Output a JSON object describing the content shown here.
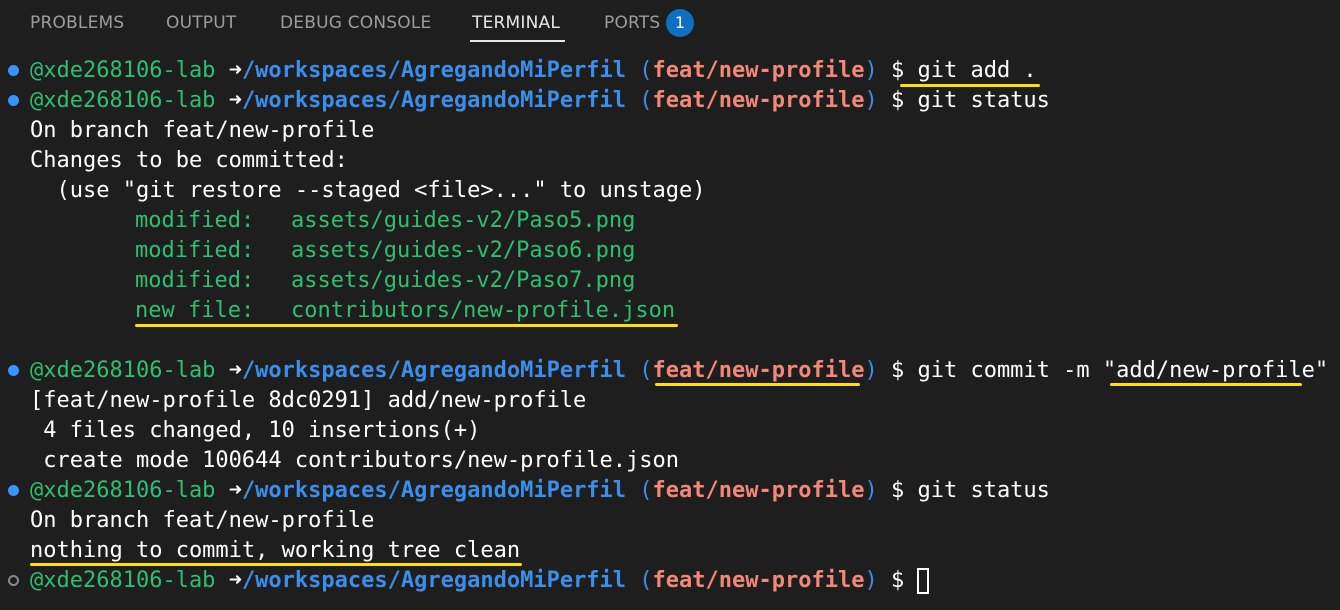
{
  "panel": {
    "tabs": [
      {
        "label": "PROBLEMS"
      },
      {
        "label": "OUTPUT"
      },
      {
        "label": "DEBUG CONSOLE"
      },
      {
        "label": "TERMINAL"
      },
      {
        "label": "PORTS"
      }
    ],
    "ports_badge": "1",
    "active_tab": "TERMINAL"
  },
  "prompt": {
    "user": "@xde268106-lab",
    "arrow": "➜",
    "path": "/workspaces/AgregandoMiPerfil",
    "branch": "feat/new-profile",
    "symbol": "$"
  },
  "terminal": {
    "cmd1": "git add .",
    "cmd2": "git status",
    "status1": {
      "branch_line": "On branch feat/new-profile",
      "changes_line": "Changes to be committed:",
      "hint_line": "  (use \"git restore --staged <file>...\" to unstage)",
      "entries": [
        {
          "status": "modified:",
          "file": "assets/guides-v2/Paso5.png"
        },
        {
          "status": "modified:",
          "file": "assets/guides-v2/Paso6.png"
        },
        {
          "status": "modified:",
          "file": "assets/guides-v2/Paso7.png"
        },
        {
          "status": "new file:",
          "file": "contributors/new-profile.json"
        }
      ]
    },
    "cmd3_prefix": "git commit -m \"",
    "cmd3_message": "add/new-profile",
    "cmd3_suffix": "\"",
    "commit_output": [
      "[feat/new-profile 8dc0291] add/new-profile",
      " 4 files changed, 10 insertions(+)",
      " create mode 100644 contributors/new-profile.json"
    ],
    "cmd4": "git status",
    "status2": {
      "branch_line": "On branch feat/new-profile",
      "clean_line": "nothing to commit, working tree clean"
    }
  },
  "colors": {
    "background": "#1e1e1e",
    "user": "#2fbf71",
    "path": "#3b8eea",
    "branch": "#f38878",
    "highlight": "#ffe100",
    "badge": "#0e70c0"
  }
}
